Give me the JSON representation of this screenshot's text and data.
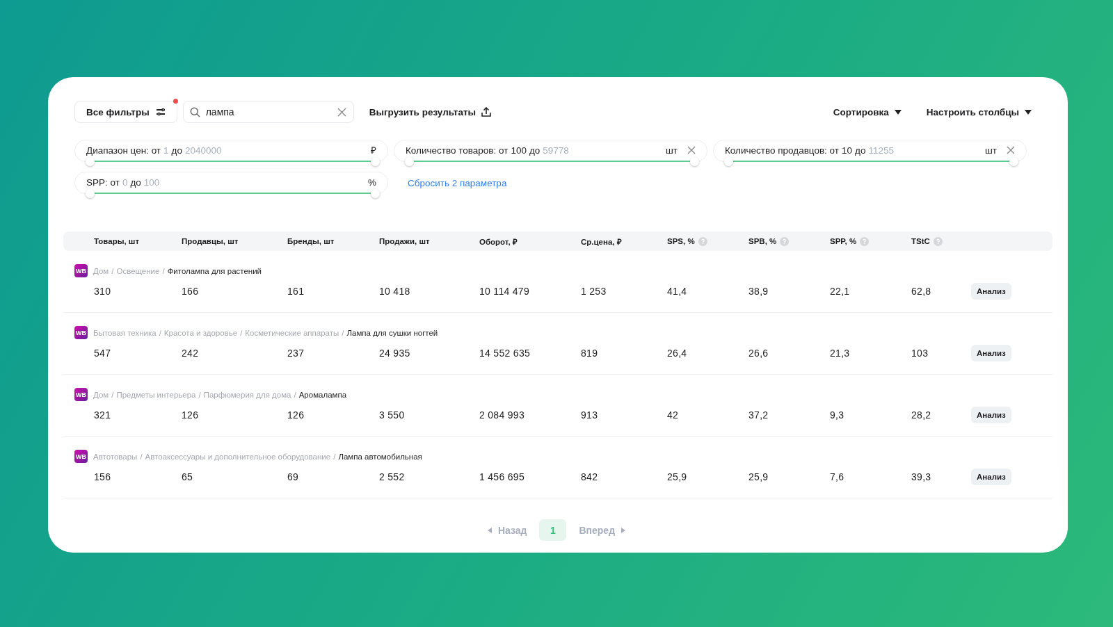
{
  "toolbar": {
    "filters_button": {
      "label": "Все фильтры",
      "has_notification": true
    },
    "search": {
      "value": "лампа"
    },
    "export_button": {
      "label": "Выгрузить результаты"
    },
    "sort_dropdown": {
      "label": "Сортировка"
    },
    "columns_dropdown": {
      "label": "Настроить столбцы"
    }
  },
  "filters": [
    {
      "label": "Диапазон цен: от",
      "from": {
        "text": "1",
        "set": false
      },
      "to_label": "до",
      "to": {
        "text": "2040000",
        "set": false
      },
      "unit": "₽",
      "removable": false,
      "thumbs": [
        {
          "level": 0
        },
        {
          "level": 1
        }
      ]
    },
    {
      "label": "Количество товаров: от",
      "from": {
        "text": "100",
        "set": true
      },
      "to_label": "до",
      "to": {
        "text": "59778",
        "set": false
      },
      "unit": "шт",
      "removable": true,
      "thumbs": [
        {
          "level": 0
        },
        {
          "level": 1
        }
      ]
    },
    {
      "label": "Количество продавцов: от",
      "from": {
        "text": "10",
        "set": true
      },
      "to_label": "до",
      "to": {
        "text": "11255",
        "set": false
      },
      "unit": "шт",
      "removable": true,
      "thumbs": [
        {
          "level": 0
        },
        {
          "level": 1
        }
      ]
    },
    {
      "label": "SPP: от",
      "from": {
        "text": "0",
        "set": false
      },
      "to_label": "до",
      "to": {
        "text": "100",
        "set": false
      },
      "unit": "%",
      "removable": false,
      "thumbs": [
        {
          "level": 0
        },
        {
          "level": 1
        }
      ]
    }
  ],
  "reset_link": "Сбросить 2 параметра",
  "table": {
    "columns": [
      {
        "label": "Товары, шт",
        "help": false
      },
      {
        "label": "Продавцы, шт",
        "help": false
      },
      {
        "label": "Бренды, шт",
        "help": false
      },
      {
        "label": "Продажи, шт",
        "help": false
      },
      {
        "label": "Оборот, ₽",
        "help": false
      },
      {
        "label": "Ср.цена, ₽",
        "help": false
      },
      {
        "label": "SPS, %",
        "help": true
      },
      {
        "label": "SPB, %",
        "help": true
      },
      {
        "label": "SPP, %",
        "help": true
      },
      {
        "label": "TStC",
        "help": true
      }
    ],
    "rows": [
      {
        "badge": "WB",
        "separator": "/",
        "path": [
          "Дом",
          "Освещение"
        ],
        "category": "Фитолампа для растений",
        "cells": [
          "310",
          "166",
          "161",
          "10 418",
          "10 114 479",
          "1 253",
          "41,4",
          "38,9",
          "22,1",
          "62,8"
        ],
        "action": "Анализ"
      },
      {
        "badge": "WB",
        "separator": "/",
        "path": [
          "Бытовая техника",
          "Красота и здоровье",
          "Косметические аппараты"
        ],
        "category": "Лампа для сушки ногтей",
        "cells": [
          "547",
          "242",
          "237",
          "24 935",
          "14 552 635",
          "819",
          "26,4",
          "26,6",
          "21,3",
          "103"
        ],
        "action": "Анализ"
      },
      {
        "badge": "WB",
        "separator": "/",
        "path": [
          "Дом",
          "Предметы интерьера",
          "Парфюмерия для дома"
        ],
        "category": "Аромалампа",
        "cells": [
          "321",
          "126",
          "126",
          "3 550",
          "2 084 993",
          "913",
          "42",
          "37,2",
          "9,3",
          "28,2"
        ],
        "action": "Анализ"
      },
      {
        "badge": "WB",
        "separator": "/",
        "path": [
          "Автотовары",
          "Автоаксессуары и дополнительное оборудование"
        ],
        "category": "Лампа автомобильная",
        "cells": [
          "156",
          "65",
          "69",
          "2 552",
          "1 456 695",
          "842",
          "25,9",
          "25,9",
          "7,6",
          "39,3"
        ],
        "action": "Анализ"
      }
    ]
  },
  "pagination": {
    "prev": {
      "label": "Назад",
      "disabled": true
    },
    "pages": [
      {
        "label": "1",
        "selected": true
      }
    ],
    "next": {
      "label": "Вперед",
      "disabled": true
    }
  }
}
